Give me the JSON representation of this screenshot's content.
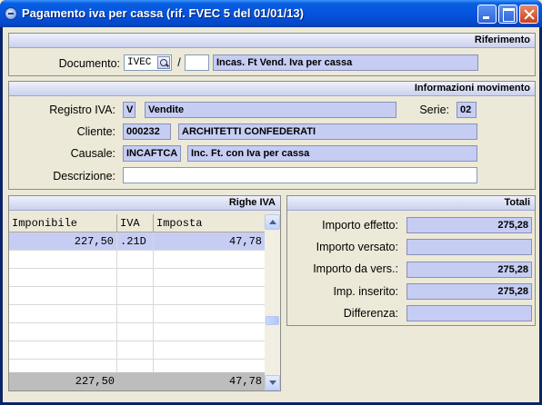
{
  "window": {
    "title": "Pagamento iva per cassa (rif. FVEC 5 del 01/01/13)"
  },
  "riferimento": {
    "header": "Riferimento",
    "documento_label": "Documento:",
    "documento_code": "IVEC",
    "separator": "/",
    "documento_number": "",
    "documento_desc": "Incas. Ft Vend. Iva per cassa"
  },
  "movimento": {
    "header": "Informazioni movimento",
    "registro_label": "Registro IVA:",
    "registro_code": "V",
    "registro_desc": "Vendite",
    "serie_label": "Serie:",
    "serie_value": "02",
    "cliente_label": "Cliente:",
    "cliente_code": "000232",
    "cliente_name": "ARCHITETTI CONFEDERATI",
    "causale_label": "Causale:",
    "causale_code": "INCAFTCA",
    "causale_desc": "Inc. Ft. con Iva per cassa",
    "descrizione_label": "Descrizione:",
    "descrizione_value": ""
  },
  "righe": {
    "header": "Righe IVA",
    "columns": [
      "Imponibile",
      "IVA",
      "Imposta"
    ],
    "rows": [
      {
        "imponibile": "227,50",
        "iva": ".21D",
        "imposta": "47,78"
      }
    ],
    "totals": {
      "imponibile": "227,50",
      "imposta": "47,78"
    }
  },
  "totali": {
    "header": "Totali",
    "items": [
      {
        "label": "Importo effetto:",
        "value": "275,28"
      },
      {
        "label": "Importo versato:",
        "value": ""
      },
      {
        "label": "Importo da vers.:",
        "value": "275,28"
      },
      {
        "label": "Imp. inserito:",
        "value": "275,28"
      },
      {
        "label": "Differenza:",
        "value": ""
      }
    ]
  }
}
